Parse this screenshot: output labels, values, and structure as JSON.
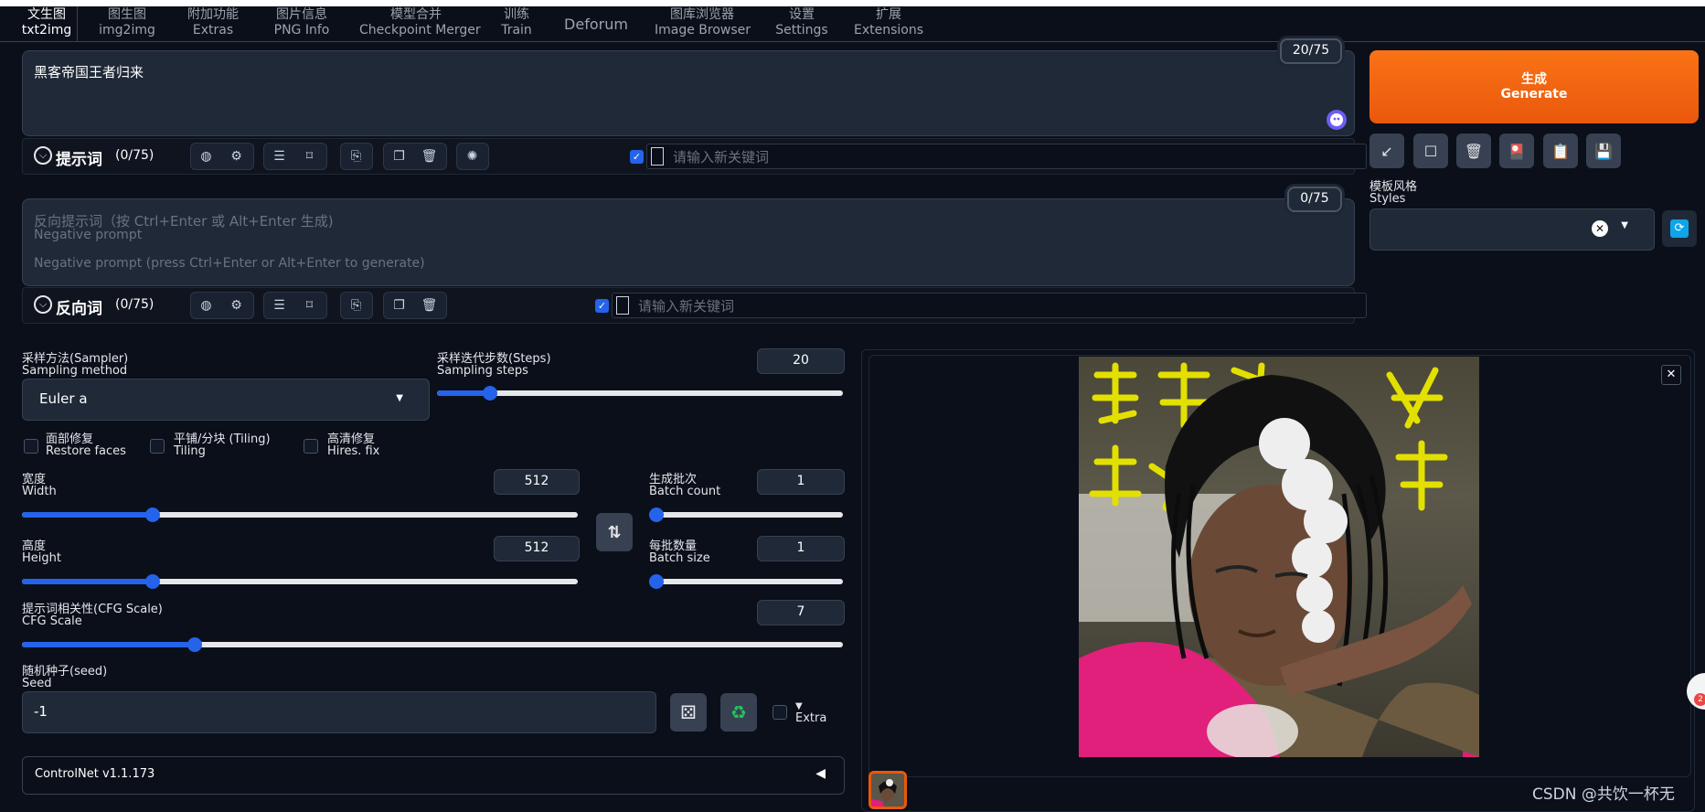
{
  "tabs": [
    {
      "cn": "文生图",
      "en": "txt2img"
    },
    {
      "cn": "图生图",
      "en": "img2img"
    },
    {
      "cn": "附加功能",
      "en": "Extras"
    },
    {
      "cn": "图片信息",
      "en": "PNG Info"
    },
    {
      "cn": "模型合并",
      "en": "Checkpoint Merger"
    },
    {
      "cn": "训练",
      "en": "Train"
    },
    {
      "label": "Deforum"
    },
    {
      "cn": "图库浏览器",
      "en": "Image Browser"
    },
    {
      "cn": "设置",
      "en": "Settings"
    },
    {
      "cn": "扩展",
      "en": "Extensions"
    }
  ],
  "prompt": {
    "text": "黑客帝国王者归来",
    "token_count": "20/75",
    "section_label": "提示词",
    "section_count": "(0/75)",
    "keyword_placeholder": "请输入新关键词"
  },
  "negative_prompt": {
    "placeholder_line1": "反向提示词（按 Ctrl+Enter 或 Alt+Enter 生成)",
    "placeholder_line2": "Negative prompt",
    "placeholder_line3": "Negative prompt (press Ctrl+Enter or Alt+Enter to generate)",
    "token_count": "0/75",
    "section_label": "反向词",
    "section_count": "(0/75)",
    "keyword_placeholder": "请输入新关键词"
  },
  "generate": {
    "cn": "生成",
    "en": "Generate"
  },
  "styles": {
    "cn": "模板风格",
    "en": "Styles"
  },
  "sampler": {
    "label_cn": "采样方法(Sampler)",
    "label_en": "Sampling method",
    "value": "Euler a"
  },
  "steps": {
    "label_cn": "采样迭代步数(Steps)",
    "label_en": "Sampling steps",
    "value": "20",
    "fraction": 0.13
  },
  "checkboxes": [
    {
      "cn": "面部修复",
      "en": "Restore faces"
    },
    {
      "cn": "平铺/分块 (Tiling)",
      "en": "Tiling"
    },
    {
      "cn": "高清修复",
      "en": "Hires. fix"
    }
  ],
  "width": {
    "label_cn": "宽度",
    "label_en": "Width",
    "value": "512",
    "fraction": 0.235
  },
  "height": {
    "label_cn": "高度",
    "label_en": "Height",
    "value": "512",
    "fraction": 0.235
  },
  "batch_count": {
    "label_cn": "生成批次",
    "label_en": "Batch count",
    "value": "1",
    "fraction": 0.0
  },
  "batch_size": {
    "label_cn": "每批数量",
    "label_en": "Batch size",
    "value": "1",
    "fraction": 0.0
  },
  "cfg": {
    "label_cn": "提示词相关性(CFG Scale)",
    "label_en": "CFG Scale",
    "value": "7",
    "fraction": 0.21
  },
  "seed": {
    "label_cn": "随机种子(seed)",
    "label_en": "Seed",
    "value": "-1",
    "extra_label": "Extra"
  },
  "controlnet": {
    "label": "ControlNet v1.1.173"
  },
  "watermark": "CSDN @共饮一杯无",
  "colors": {
    "accent": "#2563eb",
    "generate": "#ea580c",
    "background": "#0b0f19"
  }
}
